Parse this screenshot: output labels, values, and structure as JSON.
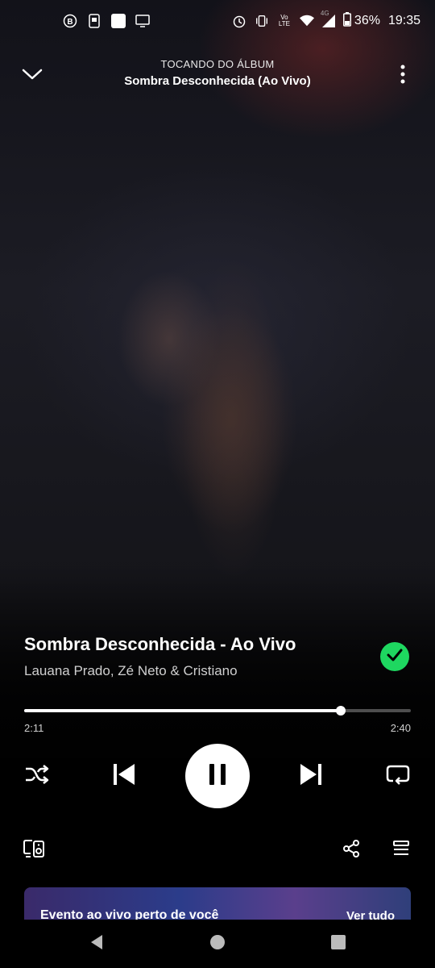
{
  "status_bar": {
    "battery": "36%",
    "time": "19:35",
    "network_label": "4G",
    "lte_label": "Vo LTE",
    "icons": [
      "b-badge-icon",
      "app-icon",
      "square-icon",
      "cast-screen-icon",
      "alarm-icon",
      "vibrate-icon",
      "volte-icon",
      "wifi-icon",
      "signal-icon",
      "battery-icon"
    ]
  },
  "header": {
    "context_label": "TOCANDO DO ÁLBUM",
    "context_name": "Sombra Desconhecida (Ao Vivo)"
  },
  "track": {
    "title": "Sombra Desconhecida - Ao Vivo",
    "artists": "Lauana Prado, Zé Neto & Cristiano",
    "liked": true
  },
  "progress": {
    "elapsed": "2:11",
    "duration": "2:40",
    "fraction": 0.819
  },
  "controls": {
    "shuffle": "shuffle-icon",
    "previous": "previous-icon",
    "play_pause": "pause-icon",
    "next": "next-icon",
    "repeat": "repeat-icon"
  },
  "bottom": {
    "devices": "devices-icon",
    "share": "share-icon",
    "queue": "queue-icon"
  },
  "banner": {
    "title": "Evento ao vivo perto de você",
    "link": "Ver tudo"
  },
  "colors": {
    "accent": "#1ed760",
    "background": "#000000",
    "text": "#ffffff"
  }
}
